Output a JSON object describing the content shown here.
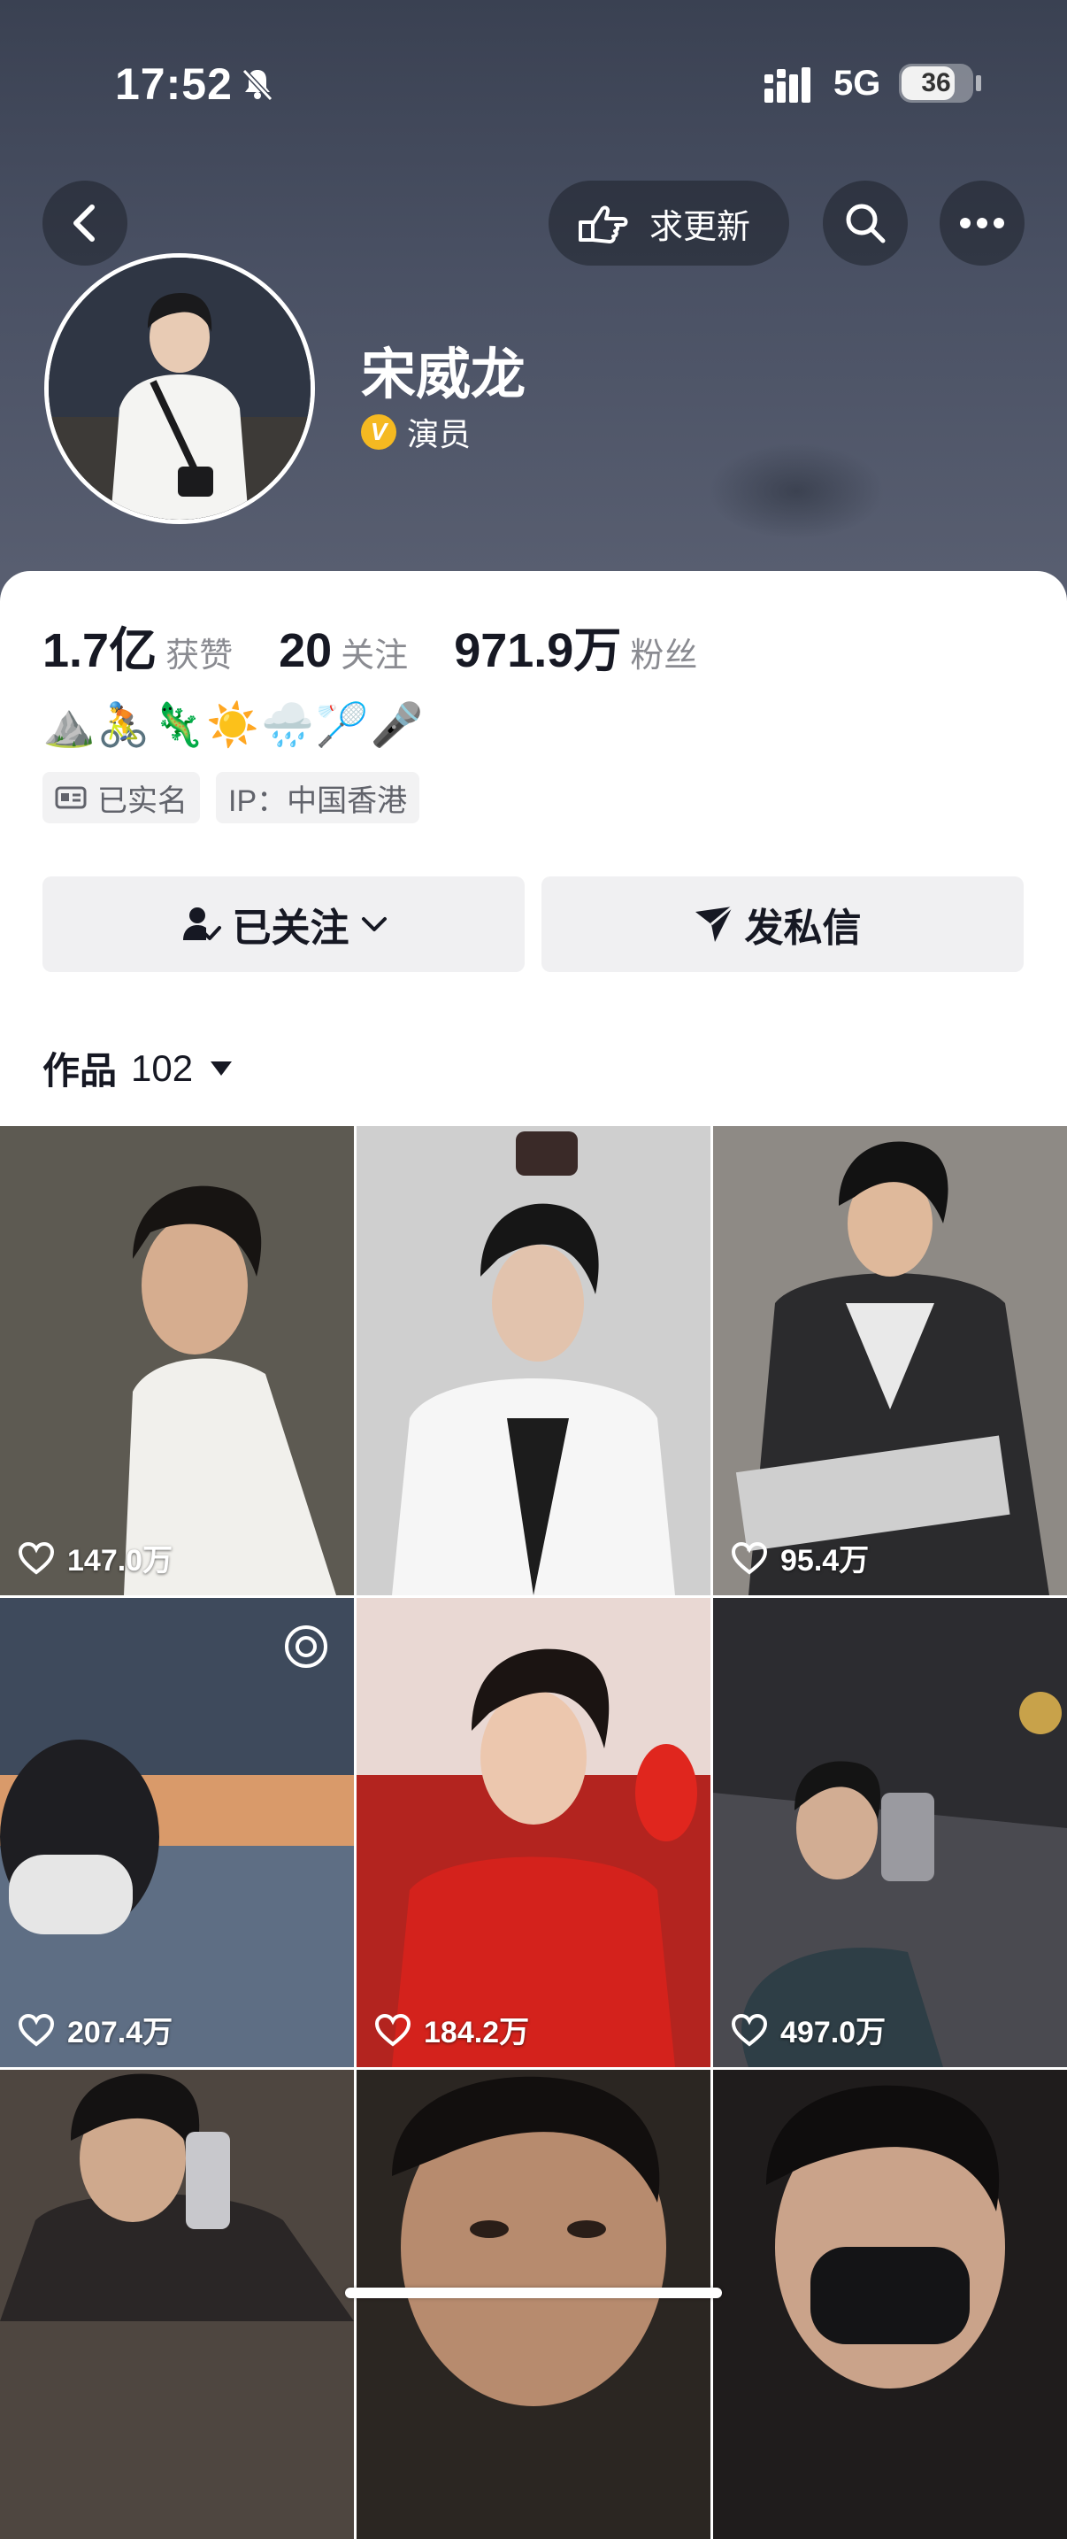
{
  "status_bar": {
    "time": "17:52",
    "network": "5G",
    "battery": "36"
  },
  "top_bar": {
    "request_update_label": "求更新"
  },
  "profile": {
    "name": "宋威龙",
    "verification": "演员",
    "stats": [
      {
        "value": "1.7亿",
        "label": "获赞"
      },
      {
        "value": "20",
        "label": "关注"
      },
      {
        "value": "971.9万",
        "label": "粉丝"
      }
    ],
    "emoji_bio": "⛰️🚴🦎☀️🌧️🏸🎤",
    "tags": [
      "已实名",
      "IP：中国香港"
    ]
  },
  "actions": {
    "followed_label": "已关注",
    "message_label": "发私信"
  },
  "works": {
    "label": "作品",
    "count": "102"
  },
  "grid": [
    {
      "likes": "147.0万",
      "bg": "#5d5a52"
    },
    {
      "likes": "",
      "bg": "#cfcfcf"
    },
    {
      "likes": "95.4万",
      "bg": "#8e8a85"
    },
    {
      "likes": "207.4万",
      "bg": "#3e4a5c"
    },
    {
      "likes": "184.2万",
      "bg": "#b3241f"
    },
    {
      "likes": "497.0万",
      "bg": "#2c2c30"
    },
    {
      "likes": "",
      "bg": "#4e4640"
    },
    {
      "likes": "",
      "bg": "#2b2622"
    },
    {
      "likes": "",
      "bg": "#1f1c1c"
    }
  ]
}
